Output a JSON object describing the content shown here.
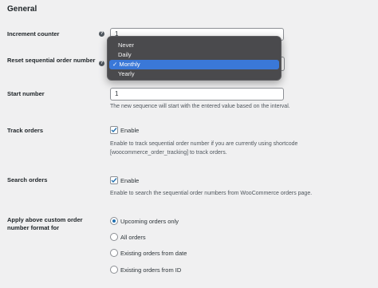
{
  "section": {
    "title": "General"
  },
  "increment_counter": {
    "label": "Increment counter",
    "value": "1"
  },
  "reset_sequential": {
    "label": "Reset sequential order number",
    "options": [
      "Never",
      "Daily",
      "Monthly",
      "Yearly"
    ],
    "selected": "Monthly"
  },
  "start_number": {
    "label": "Start number",
    "value": "1",
    "description": "The new sequence will start with the entered value based on the interval."
  },
  "track_orders": {
    "label": "Track orders",
    "checkbox_label": "Enable",
    "checked": true,
    "description_line1": "Enable to track sequential order number if you are currently using shortcode",
    "description_line2": "[woocommerce_order_tracking] to track orders."
  },
  "search_orders": {
    "label": "Search orders",
    "checkbox_label": "Enable",
    "checked": true,
    "description": "Enable to search the sequential order numbers from WooCommerce orders page."
  },
  "apply_format": {
    "label": "Apply above custom order number format for",
    "options": [
      "Upcoming orders only",
      "All orders",
      "Existing orders from date",
      "Existing orders from ID"
    ],
    "selected": "Upcoming orders only"
  },
  "icons": {
    "help": "question-icon",
    "check": "checkmark-icon"
  },
  "colors": {
    "accent": "#2271b1",
    "dropdown_bg": "#4a4a4d",
    "dropdown_selected": "#3a78d8"
  }
}
